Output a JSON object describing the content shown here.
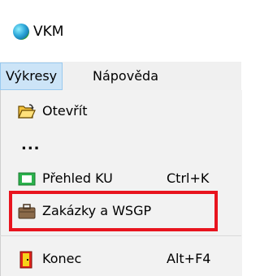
{
  "window": {
    "title": "VKM",
    "icon": "app-globe-icon"
  },
  "menubar": {
    "items": [
      {
        "label": "Výkresy",
        "active": true
      },
      {
        "label": "Nápověda",
        "active": false
      }
    ]
  },
  "dropdown": {
    "items": [
      {
        "label": "Otevřít",
        "shortcut": "",
        "icon": "open-folder-icon"
      },
      {
        "label": "...",
        "shortcut": "",
        "icon": ""
      },
      {
        "label": "Přehled KU",
        "shortcut": "Ctrl+K",
        "icon": "overview-icon"
      },
      {
        "label": "Zakázky a WSGP",
        "shortcut": "",
        "icon": "briefcase-icon",
        "highlighted": true
      },
      {
        "label": "Konec",
        "shortcut": "Alt+F4",
        "icon": "exit-door-icon"
      }
    ]
  },
  "colors": {
    "highlight": "#e8141e",
    "menu_active": "#cce4f7"
  }
}
